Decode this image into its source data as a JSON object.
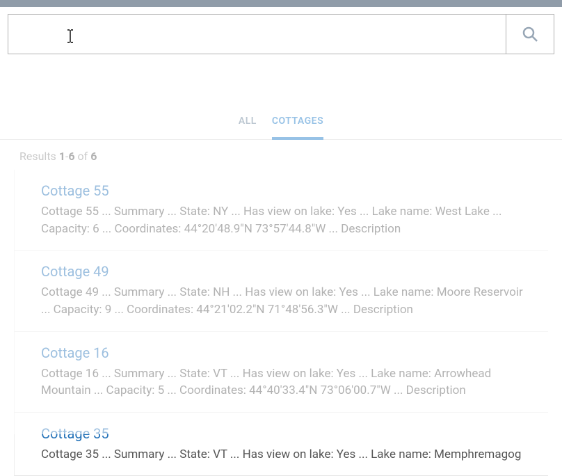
{
  "search": {
    "value": "",
    "placeholder": ""
  },
  "tabs": [
    {
      "label": "ALL",
      "active": false
    },
    {
      "label": "COTTAGES",
      "active": true
    }
  ],
  "results_meta": {
    "prefix": "Results ",
    "from": "1",
    "dash": "-",
    "to": "6",
    "of_text": " of ",
    "total": "6"
  },
  "results": [
    {
      "title": "Cottage 55",
      "snippet": "Cottage 55 ... Summary ... State: NY ... Has view on lake: Yes ... Lake name: West Lake ... Capacity: 6 ... Coordinates: 44°20'48.9\"N 73°57'44.8\"W ... Description"
    },
    {
      "title": "Cottage 49",
      "snippet": "Cottage 49 ... Summary ... State: NH ... Has view on lake: Yes ... Lake name: Moore Reservoir ... Capacity: 9 ... Coordinates: 44°21'02.2\"N 71°48'56.3\"W ... Description"
    },
    {
      "title": "Cottage 16",
      "snippet": "Cottage 16 ... Summary ... State: VT ... Has view on lake: Yes ... Lake name: Arrowhead Mountain ... Capacity: 5 ... Coordinates: 44°40'33.4\"N 73°06'00.7\"W ... Description"
    },
    {
      "title": "Cottage 35",
      "snippet": "Cottage 35 ... Summary ... State: VT ... Has view on lake: Yes ... Lake name: Memphremagog"
    }
  ]
}
